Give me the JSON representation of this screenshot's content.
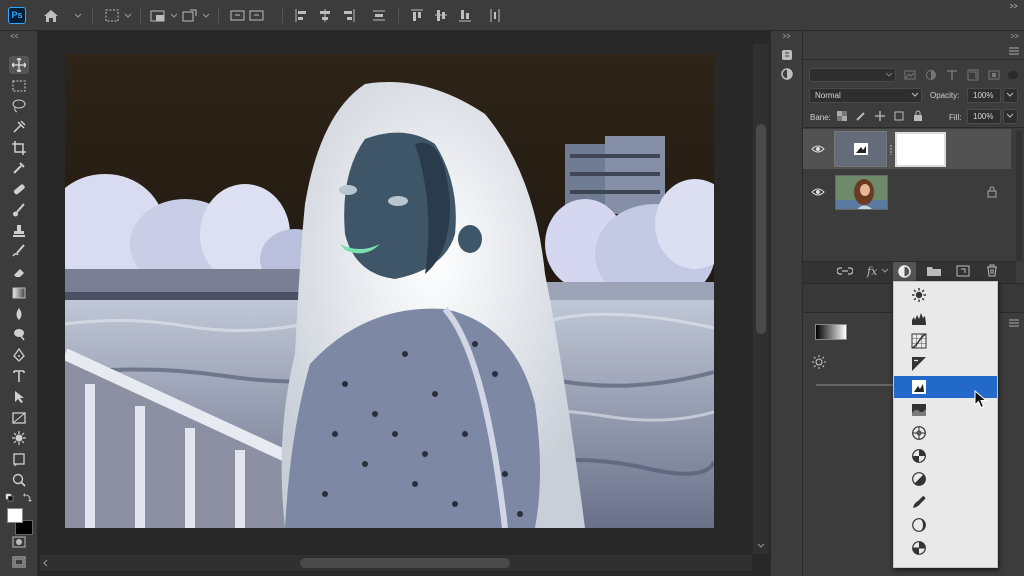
{
  "app": {
    "logo_text": "Ps"
  },
  "options_bar": {
    "icons": [
      "home-icon",
      "marquee-options-icon",
      "mode-icon",
      "transform-icon",
      "align-options-icon",
      "align-left-icon",
      "align-center-icon",
      "align-right-icon",
      "distribute-icon",
      "align-top-icon",
      "align-middle-icon",
      "align-bottom-icon"
    ]
  },
  "toolbar": {
    "tools": [
      "move-tool",
      "marquee-tool",
      "lasso-tool",
      "quick-select-tool",
      "crop-tool",
      "eyedropper-tool",
      "healing-brush-tool",
      "brush-tool",
      "clone-stamp-tool",
      "history-brush-tool",
      "eraser-tool",
      "gradient-tool",
      "blur-tool",
      "dodge-tool",
      "pen-tool",
      "type-tool",
      "path-select-tool",
      "shape-tool",
      "hand-tool",
      "zoom-tool",
      "extras-tool"
    ],
    "foreground_color": "#ffffff",
    "background_color": "#000000"
  },
  "layers_panel": {
    "blend_mode": "Normal",
    "opacity_label": "Opacity:",
    "opacity_value": "100%",
    "lock_label": "Bane:",
    "fill_label": "Fill:",
    "fill_value": "100%",
    "layers": [
      {
        "type": "adjustment",
        "visible": true
      },
      {
        "type": "image",
        "visible": true,
        "locked": true
      }
    ]
  },
  "adjustment_menu": {
    "items": [
      "brightness-contrast",
      "levels",
      "curves",
      "exposure",
      "invert",
      "vibrance",
      "hue-saturation",
      "color-balance",
      "black-white",
      "channel-mixer",
      "photo-filter",
      "selective-color"
    ],
    "selected_index": 4
  },
  "colors": {
    "accent": "#2369c9",
    "panel": "#3c3c3c",
    "canvas": "#282828"
  }
}
